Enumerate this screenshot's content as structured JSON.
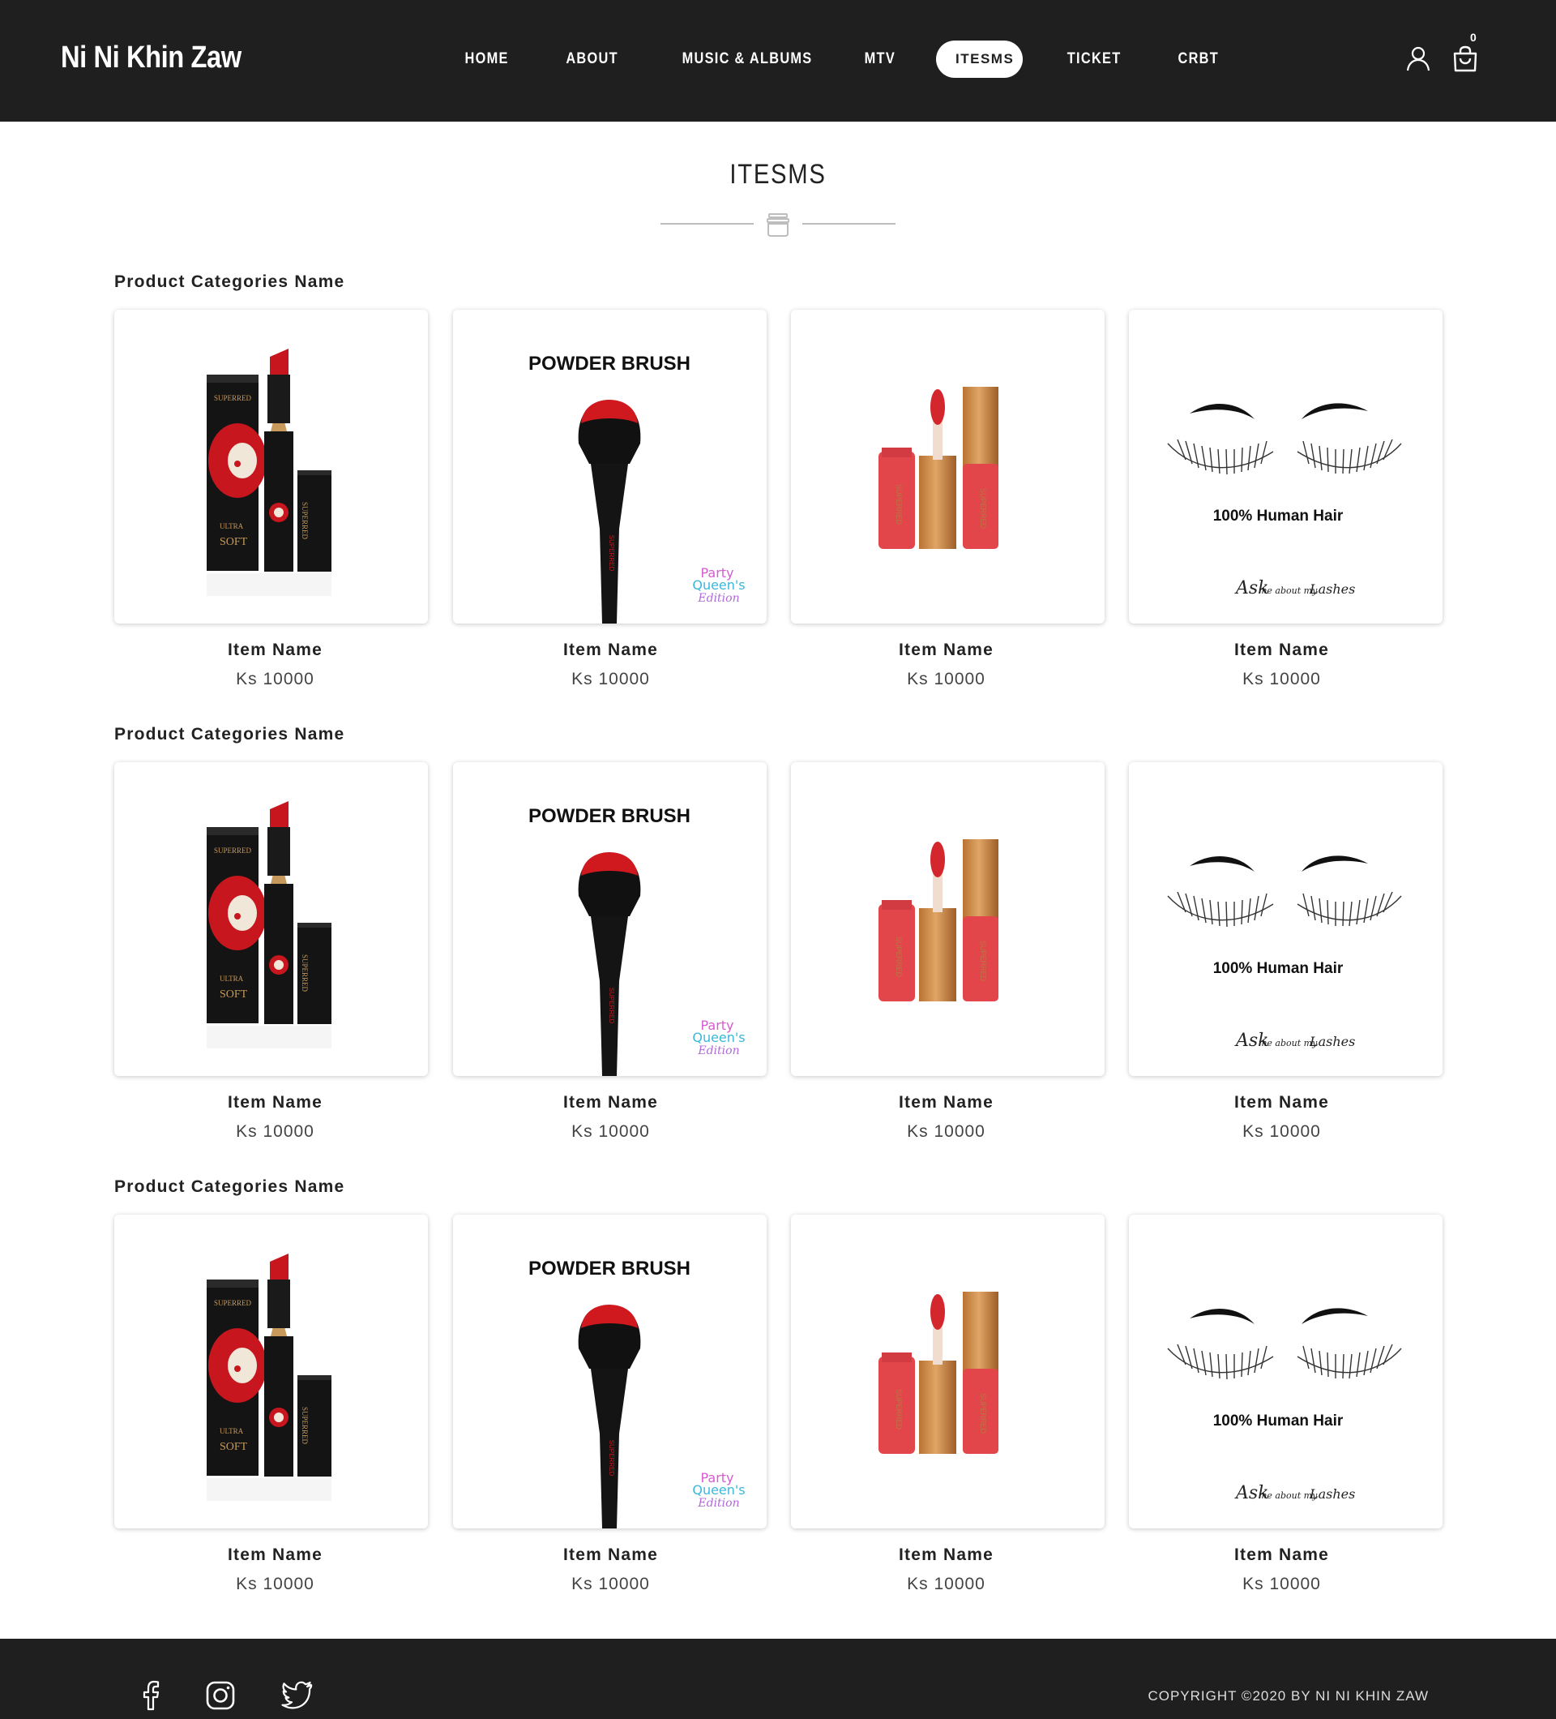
{
  "header": {
    "logo": "Ni Ni Khin Zaw",
    "nav": [
      {
        "label": "HOME"
      },
      {
        "label": "ABOUT"
      },
      {
        "label": "MUSIC & ALBUMS"
      },
      {
        "label": "MTV"
      },
      {
        "label": "ITESMS",
        "active": true
      },
      {
        "label": "TICKET"
      },
      {
        "label": "CRBT"
      }
    ],
    "cart_count": "0",
    "icons": [
      "user-icon",
      "shopping-bag-icon"
    ]
  },
  "page": {
    "title": "ITESMS",
    "divider_icon": "bowl-icon"
  },
  "sections": [
    {
      "title": "Product Categories Name",
      "items": [
        {
          "image": "lipstick",
          "name": "Item Name",
          "price": "Ks 10000"
        },
        {
          "image": "powder-brush",
          "image_text": "POWDER BRUSH",
          "badge": [
            "Party",
            "Queen's",
            "Edition"
          ],
          "name": "Item Name",
          "price": "Ks 10000"
        },
        {
          "image": "lip-gloss",
          "name": "Item Name",
          "price": "Ks 10000"
        },
        {
          "image": "lashes",
          "image_text": "100% Human Hair",
          "tagline": [
            "Ask",
            "me about my",
            "Lashes"
          ],
          "name": "Item Name",
          "price": "Ks 10000"
        }
      ]
    },
    {
      "title": "Product Categories Name",
      "items": [
        {
          "image": "lipstick",
          "name": "Item Name",
          "price": "Ks 10000"
        },
        {
          "image": "powder-brush",
          "image_text": "POWDER BRUSH",
          "badge": [
            "Party",
            "Queen's",
            "Edition"
          ],
          "name": "Item Name",
          "price": "Ks 10000"
        },
        {
          "image": "lip-gloss",
          "name": "Item Name",
          "price": "Ks 10000"
        },
        {
          "image": "lashes",
          "image_text": "100% Human Hair",
          "tagline": [
            "Ask",
            "me about my",
            "Lashes"
          ],
          "name": "Item Name",
          "price": "Ks 10000"
        }
      ]
    },
    {
      "title": "Product Categories Name",
      "items": [
        {
          "image": "lipstick",
          "name": "Item Name",
          "price": "Ks 10000"
        },
        {
          "image": "powder-brush",
          "image_text": "POWDER BRUSH",
          "badge": [
            "Party",
            "Queen's",
            "Edition"
          ],
          "name": "Item Name",
          "price": "Ks 10000"
        },
        {
          "image": "lip-gloss",
          "name": "Item Name",
          "price": "Ks 10000"
        },
        {
          "image": "lashes",
          "image_text": "100% Human Hair",
          "tagline": [
            "Ask",
            "me about my",
            "Lashes"
          ],
          "name": "Item Name",
          "price": "Ks 10000"
        }
      ]
    }
  ],
  "footer": {
    "social": [
      "facebook-icon",
      "instagram-icon",
      "twitter-icon"
    ],
    "copyright": "COPYRIGHT ©2020 BY NI NI KHIN ZAW"
  },
  "colors": {
    "header_bg": "#1f1f1f",
    "footer_bg": "#1f1f1f",
    "accent_red": "#d21f26"
  }
}
